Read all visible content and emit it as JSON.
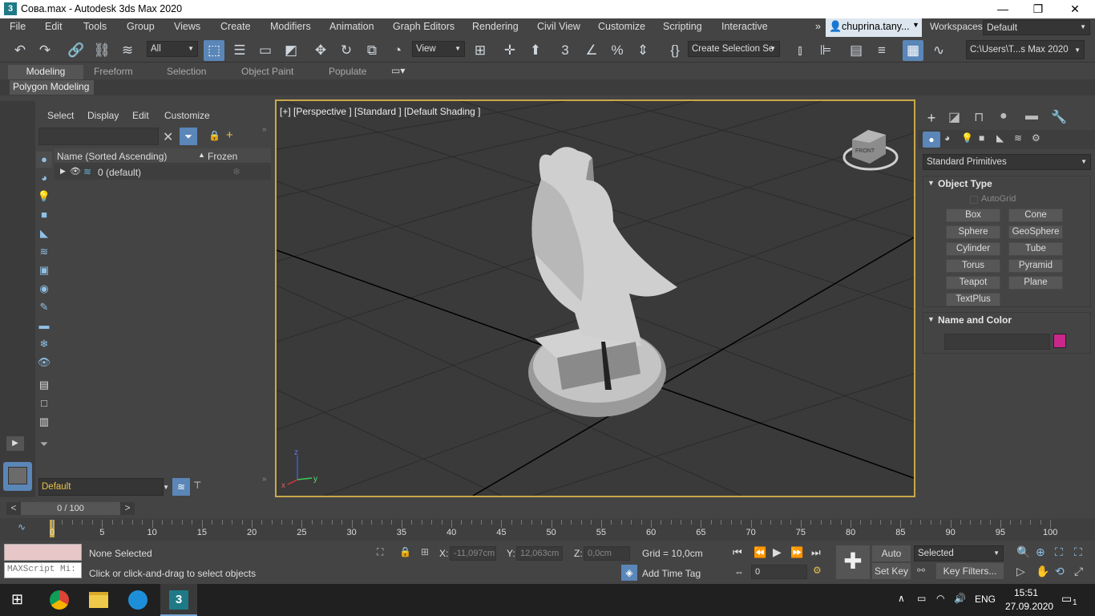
{
  "window": {
    "title": "Сова.max - Autodesk 3ds Max 2020",
    "logo": "3",
    "minimize": "—",
    "maximize": "❐",
    "close": "✕"
  },
  "menu": {
    "items": [
      "File",
      "Edit",
      "Tools",
      "Group",
      "Views",
      "Create",
      "Modifiers",
      "Animation",
      "Graph Editors",
      "Rendering",
      "Civil View",
      "Customize",
      "Scripting",
      "Interactive"
    ],
    "overflow": "»",
    "user": "chuprina.tany...",
    "workspaces_label": "Workspaces:",
    "workspace": "Default"
  },
  "toolbar": {
    "filter": "All",
    "refcoord": "View",
    "selection_set": "Create Selection Se",
    "project_path": "C:\\Users\\T...s Max 2020"
  },
  "ribbon": {
    "tabs": [
      "Modeling",
      "Freeform",
      "Selection",
      "Object Paint",
      "Populate"
    ],
    "active_panel": "Polygon Modeling"
  },
  "scene_explorer": {
    "menus": [
      "Select",
      "Display",
      "Edit",
      "Customize"
    ],
    "search_placeholder": "",
    "col_name": "Name (Sorted Ascending)",
    "col_frozen": "Frozen",
    "rows": [
      {
        "name": "0 (default)"
      }
    ],
    "layer": "Default"
  },
  "viewport": {
    "label": "[+] [Perspective ] [Standard ] [Default Shading ]",
    "viewcube_face": "FRONT",
    "axis_z": "z",
    "axis_y": "y",
    "axis_x": "x"
  },
  "command_panel": {
    "category": "Standard Primitives",
    "object_type": "Object Type",
    "autogrid": "AutoGrid",
    "buttons": [
      "Box",
      "Cone",
      "Sphere",
      "GeoSphere",
      "Cylinder",
      "Tube",
      "Torus",
      "Pyramid",
      "Teapot",
      "Plane",
      "TextPlus"
    ],
    "name_color": "Name and Color",
    "color": "#c8288a"
  },
  "timeline": {
    "frame": "0 / 100",
    "prev": "<",
    "next": ">",
    "ticks": [
      "0",
      "5",
      "10",
      "15",
      "20",
      "25",
      "30",
      "35",
      "40",
      "45",
      "50",
      "55",
      "60",
      "65",
      "70",
      "75",
      "80",
      "85",
      "90",
      "95",
      "100"
    ]
  },
  "status": {
    "maxscript": "MAXScript Mi:",
    "selection": "None Selected",
    "hint": "Click or click-and-drag to select objects",
    "x_label": "X:",
    "x": "-11,097cm",
    "y_label": "Y:",
    "y": "12,063cm",
    "z_label": "Z:",
    "z": "0,0cm",
    "grid": "Grid = 10,0cm",
    "add_time_tag": "Add Time Tag",
    "frame_field": "0",
    "auto_key": "Auto Key",
    "set_key": "Set Key",
    "selected": "Selected",
    "key_filters": "Key Filters..."
  },
  "taskbar": {
    "lang": "ENG",
    "time": "15:51",
    "date": "27.09.2020",
    "notif": "1"
  }
}
